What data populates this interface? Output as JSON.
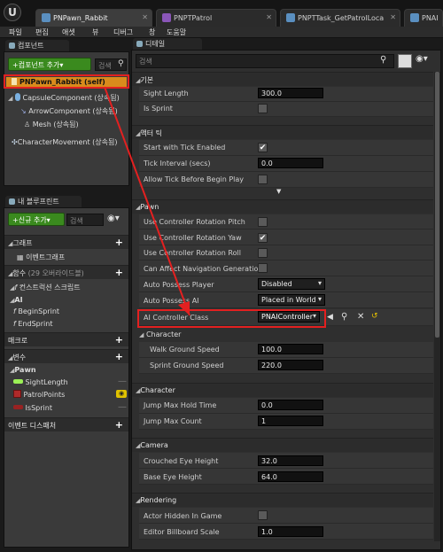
{
  "tabs": [
    {
      "label": "PNPawn_Rabbit",
      "active": true
    },
    {
      "label": "PNPTPatrol",
      "active": false
    },
    {
      "label": "PNPTTask_GetPatrolLoca",
      "active": false
    },
    {
      "label": "PNAI",
      "active": false
    }
  ],
  "menu": [
    "파일",
    "편집",
    "애셋",
    "뷰",
    "디버그",
    "창",
    "도움말"
  ],
  "components": {
    "tab": "컴포넌트",
    "add_button": "+컴포넌트 추가▾",
    "search_placeholder": "검색",
    "items": [
      {
        "label": "PNPawn_Rabbit (self)"
      },
      {
        "label": "CapsuleComponent (상속됨)"
      },
      {
        "label": "ArrowComponent (상속됨)"
      },
      {
        "label": "Mesh (상속됨)"
      },
      {
        "label": "CharacterMovement (상속됨)"
      }
    ]
  },
  "myblueprint": {
    "tab": "내 블루프린트",
    "add_button": "+신규 추가▾",
    "search_placeholder": "검색",
    "sections": {
      "graph": "그래프",
      "event_graph": "이벤트그래프",
      "functions": "함수",
      "functions_note": "(29 오버라이드블)",
      "construction_script": "컨스트럭션 스크립트",
      "ai": "AI",
      "begin_sprint": "BeginSprint",
      "end_sprint": "EndSprint",
      "macros": "매크로",
      "variables": "변수",
      "pawn": "Pawn",
      "var1": "SightLength",
      "var2": "PatrolPoints",
      "var3": "IsSprint",
      "event_dispatchers": "이벤트 디스패처"
    }
  },
  "details": {
    "tab": "디테일",
    "search_placeholder": "검색",
    "basic": {
      "header": "기본",
      "sight_length_label": "Sight Length",
      "sight_length_value": "300.0",
      "is_sprint_label": "Is Sprint"
    },
    "actor_tick": {
      "header": "액터 틱",
      "start_tick_label": "Start with Tick Enabled",
      "tick_interval_label": "Tick Interval (secs)",
      "tick_interval_value": "0.0",
      "allow_tick_label": "Allow Tick Before Begin Play"
    },
    "pawn": {
      "header": "Pawn",
      "pitch_label": "Use Controller Rotation Pitch",
      "yaw_label": "Use Controller Rotation Yaw",
      "roll_label": "Use Controller Rotation Roll",
      "nav_label": "Can Affect Navigation Generation",
      "auto_possess_player_label": "Auto Possess Player",
      "auto_possess_player_value": "Disabled",
      "auto_possess_ai_label": "Auto Possess AI",
      "auto_possess_ai_value": "Placed in World",
      "ai_controller_label": "AI Controller Class",
      "ai_controller_value": "PNAIController",
      "character_sub": "Character",
      "walk_speed_label": "Walk Ground Speed",
      "walk_speed_value": "100.0",
      "sprint_speed_label": "Sprint Ground Speed",
      "sprint_speed_value": "220.0"
    },
    "character": {
      "header": "Character",
      "jump_hold_label": "Jump Max Hold Time",
      "jump_hold_value": "0.0",
      "jump_count_label": "Jump Max Count",
      "jump_count_value": "1"
    },
    "camera": {
      "header": "Camera",
      "crouched_label": "Crouched Eye Height",
      "crouched_value": "32.0",
      "base_eye_label": "Base Eye Height",
      "base_eye_value": "64.0"
    },
    "rendering": {
      "header": "Rendering",
      "hidden_label": "Actor Hidden In Game",
      "billboard_label": "Editor Billboard Scale",
      "billboard_value": "1.0"
    }
  },
  "colors": {
    "accent": "#d98b1c",
    "add_button": "#3a8a1e",
    "highlight": "#e32020",
    "panel": "#3a3a3a"
  }
}
